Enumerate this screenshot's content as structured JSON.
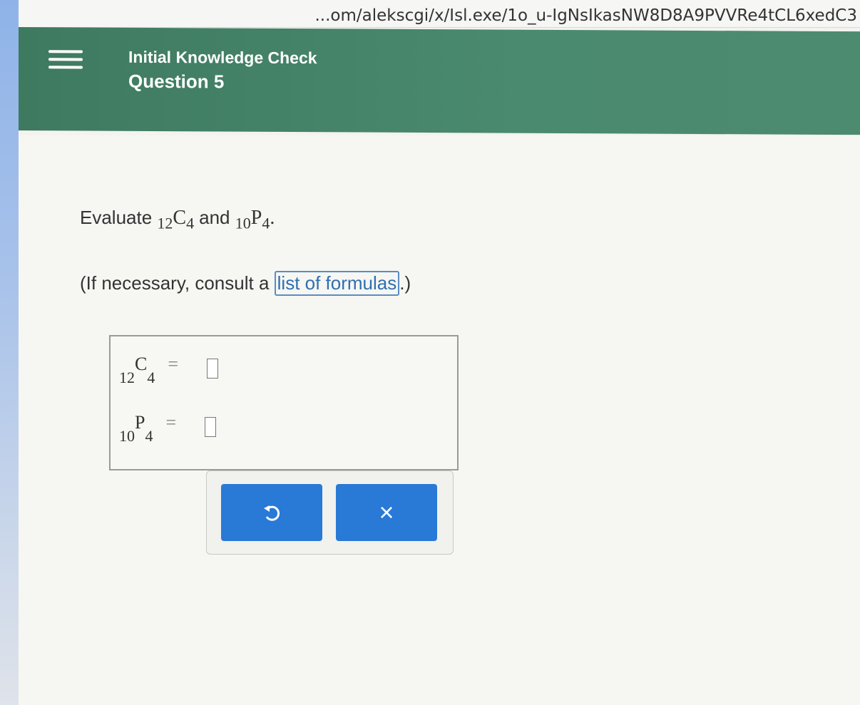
{
  "browser": {
    "url": "...om/alekscgi/x/Isl.exe/1o_u-IgNsIkasNW8D8A9PVVRe4tCL6xedC3"
  },
  "header": {
    "title": "Initial Knowledge Check",
    "subtitle": "Question 5"
  },
  "question": {
    "evaluate_label": "Evaluate",
    "c_pre": "12",
    "c_sym": "C",
    "c_sub": "4",
    "and_label": "and",
    "p_pre": "10",
    "p_sym": "P",
    "p_sub": "4",
    "period": ".",
    "hint_prefix": "(If necessary, consult a ",
    "hint_link": "list of formulas",
    "hint_suffix": ".)"
  },
  "answers": {
    "row1": {
      "pre": "12",
      "sym": "C",
      "sub": "4",
      "eq": "=",
      "value": ""
    },
    "row2": {
      "pre": "10",
      "sym": "P",
      "sub": "4",
      "eq": "=",
      "value": ""
    }
  },
  "buttons": {
    "undo_icon": "undo-icon",
    "clear_label": "×"
  }
}
